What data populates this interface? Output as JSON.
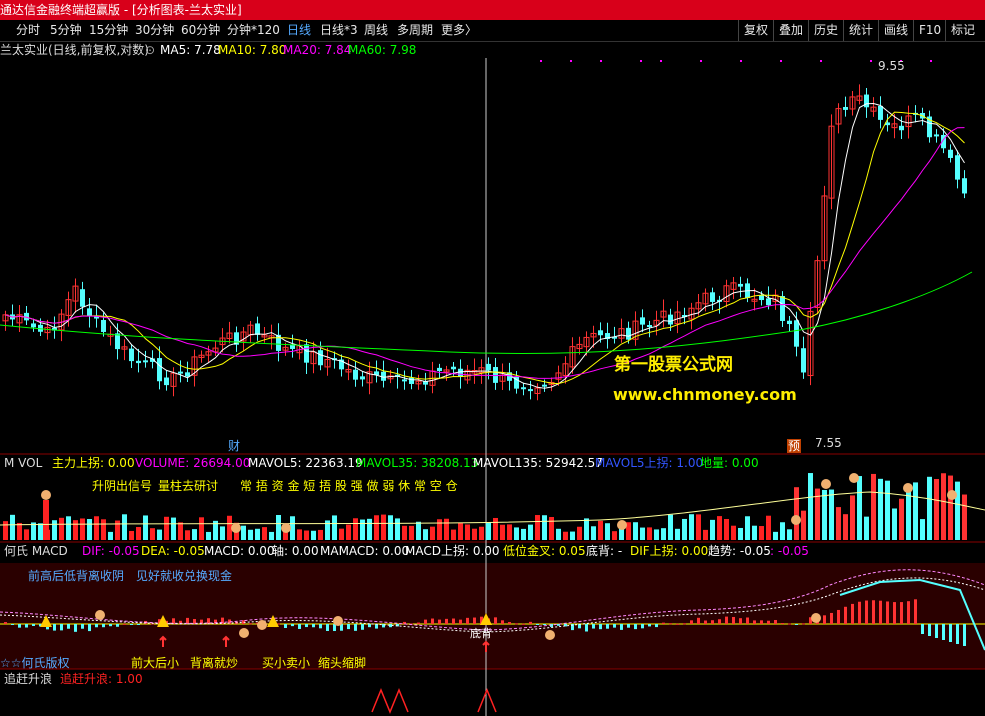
{
  "window": {
    "title": "通达信金融终端超赢版 - [分析图表-兰太实业]"
  },
  "toolbar": {
    "periods": [
      {
        "label": "分时",
        "active": false
      },
      {
        "label": "5分钟",
        "active": false
      },
      {
        "label": "15分钟",
        "active": false
      },
      {
        "label": "30分钟",
        "active": false
      },
      {
        "label": "60分钟",
        "active": false
      },
      {
        "label": "分钟*120",
        "active": false
      },
      {
        "label": "日线",
        "active": true
      },
      {
        "label": "日线*3",
        "active": false
      },
      {
        "label": "周线",
        "active": false
      },
      {
        "label": "多周期",
        "active": false
      },
      {
        "label": "更多〉",
        "active": false
      }
    ],
    "right": [
      "复权",
      "叠加",
      "历史",
      "统计",
      "画线",
      "F10",
      "标记"
    ]
  },
  "main_chart": {
    "header": "兰太实业(日线,前复权,对数)",
    "ma": [
      {
        "label": "MA5: 7.78",
        "color": "#ffffff"
      },
      {
        "label": "MA10: 7.80",
        "color": "#ffff00"
      },
      {
        "label": "MA20: 7.84",
        "color": "#ff00ff"
      },
      {
        "label": "MA60: 7.98",
        "color": "#00ff00"
      }
    ],
    "high_label": "9.55",
    "low_label": "7.55",
    "cai_marker": "财",
    "yu_marker": "预",
    "watermark_cn": "第一股票公式网",
    "watermark_url": "www.chnmoney.com"
  },
  "vol_panel": {
    "name": "M VOL",
    "indicators": [
      {
        "label": "主力上拐: 0.00",
        "color": "#ffff00"
      },
      {
        "label": "VOLUME: 26694.00",
        "color": "#ff00ff"
      },
      {
        "label": "MAVOL5: 22363.19",
        "color": "#ffffff"
      },
      {
        "label": "MAVOL35: 38208.13",
        "color": "#00ff00"
      },
      {
        "label": "MAVOL135: 52942.57",
        "color": "#ffffff"
      },
      {
        "label": "MAVOL5上拐: 1.00",
        "color": "#3355ff"
      },
      {
        "label": "地量: 0.00",
        "color": "#00ff00"
      }
    ],
    "notes": [
      "升阴出信号",
      "量柱去研讨",
      "常 捂 资 金 短 捂 股 强 做 弱 休 常 空 仓"
    ]
  },
  "macd_panel": {
    "name": "何氏 MACD",
    "indicators": [
      {
        "label": "DIF: -0.05",
        "color": "#ff00ff"
      },
      {
        "label": "DEA: -0.05",
        "color": "#ffff00"
      },
      {
        "label": "MACD: 0.00",
        "color": "#ffffff"
      },
      {
        "label": "轴: 0.00",
        "color": "#ffffff"
      },
      {
        "label": "MAMACD: 0.00",
        "color": "#ffffff"
      },
      {
        "label": "MACD上拐: 0.00",
        "color": "#ffffff"
      },
      {
        "label": "低位金叉: 0.05",
        "color": "#ffff00"
      },
      {
        "label": "底背: -",
        "color": "#ffffff"
      },
      {
        "label": "DIF上拐: 0.00",
        "color": "#ffff00"
      },
      {
        "label": "趋势: -0.05",
        "color": "#ffffff"
      },
      {
        "label": ": -0.05",
        "color": "#ff00ff"
      }
    ],
    "notes_top": [
      "前高后低背离收阴",
      "见好就收兑换现金"
    ],
    "notes_bottom": [
      "☆☆何氏版权",
      "前大后小",
      "背离就炒",
      "买小卖小",
      "缩头缩脚"
    ],
    "bottom_marker": "底背"
  },
  "chase_panel": {
    "name": "追赶升浪",
    "indicators": [
      {
        "label": "追赶升浪: 1.00",
        "color": "#ff2222"
      }
    ]
  },
  "colors": {
    "up": "#ff3333",
    "down": "#54ffff",
    "ma5": "#ffffff",
    "ma10": "#ffff00",
    "ma20": "#ff00ff",
    "ma60": "#00ff00"
  }
}
